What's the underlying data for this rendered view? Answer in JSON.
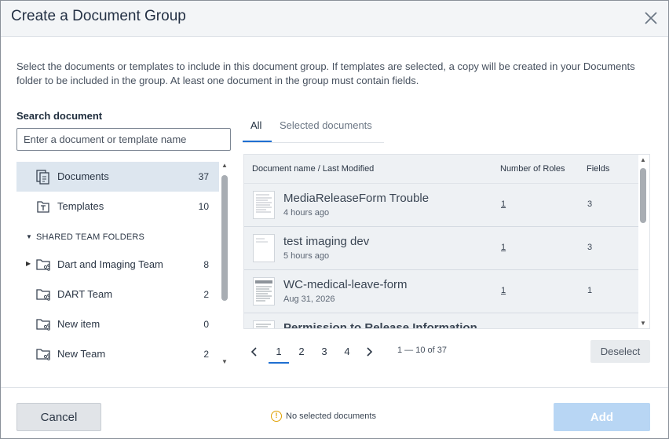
{
  "dialog": {
    "title": "Create a Document Group",
    "description": "Select the documents or templates to include in this document group. If templates are selected, a copy will be created in your Documents folder to be included in the group. At least one document in the group must contain fields."
  },
  "search": {
    "label": "Search document",
    "placeholder": "Enter a document or template name",
    "value": ""
  },
  "tree": {
    "items": [
      {
        "label": "Documents",
        "count": "37",
        "icon": "documents-icon",
        "active": true
      },
      {
        "label": "Templates",
        "count": "10",
        "icon": "template-icon"
      }
    ],
    "section_label": "SHARED TEAM FOLDERS",
    "team_folders": [
      {
        "label": "Dart and Imaging Team",
        "count": "8",
        "icon": "shared-folder-icon",
        "expandable": true
      },
      {
        "label": "DART Team",
        "count": "2",
        "icon": "shared-folder-icon"
      },
      {
        "label": "New item",
        "count": "0",
        "icon": "shared-folder-icon"
      },
      {
        "label": "New Team",
        "count": "2",
        "icon": "shared-folder-icon"
      }
    ]
  },
  "tabs": [
    {
      "label": "All",
      "active": true
    },
    {
      "label": "Selected documents",
      "active": false
    }
  ],
  "table": {
    "headers": {
      "name": "Document name / Last Modified",
      "roles": "Number of Roles",
      "fields": "Fields"
    },
    "rows": [
      {
        "name": "MediaReleaseForm Trouble",
        "modified": "4 hours ago",
        "roles": "1",
        "fields": "3"
      },
      {
        "name": "test imaging dev",
        "modified": "5 hours ago",
        "roles": "1",
        "fields": "3"
      },
      {
        "name": "WC-medical-leave-form",
        "modified": "Aug 31, 2026",
        "roles": "1",
        "fields": "1"
      },
      {
        "name": "Permission to Release Information",
        "modified": "",
        "roles": "",
        "fields": ""
      }
    ]
  },
  "pagination": {
    "pages": [
      "1",
      "2",
      "3",
      "4"
    ],
    "current_page": "1",
    "range": "1 — 10 of 37"
  },
  "buttons": {
    "deselect": "Deselect",
    "cancel": "Cancel",
    "add": "Add"
  },
  "status": {
    "text": "No selected documents"
  },
  "colors": {
    "accent": "#1f6fd1",
    "add_disabled": "#b8d6f4",
    "warning": "#e0a000"
  }
}
